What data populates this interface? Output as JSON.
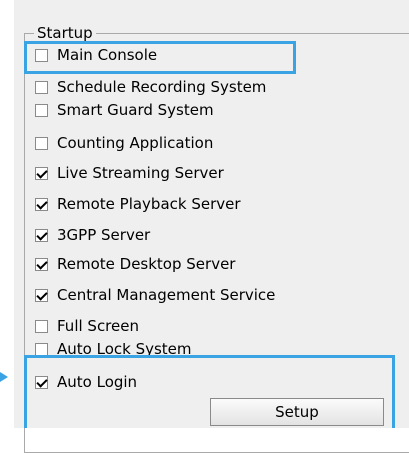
{
  "group": {
    "title": "Startup"
  },
  "items": [
    {
      "label": "Main Console",
      "checked": false
    },
    {
      "label": "Schedule Recording System",
      "checked": false
    },
    {
      "label": "Smart Guard System",
      "checked": false
    },
    {
      "label": "Counting Application",
      "checked": false
    },
    {
      "label": "Live Streaming Server",
      "checked": true
    },
    {
      "label": "Remote Playback Server",
      "checked": true
    },
    {
      "label": "3GPP Server",
      "checked": true
    },
    {
      "label": "Remote Desktop Server",
      "checked": true
    },
    {
      "label": "Central Management Service",
      "checked": true
    },
    {
      "label": "Full Screen",
      "checked": false
    },
    {
      "label": "Auto Lock System",
      "checked": false
    },
    {
      "label": "Auto Login",
      "checked": true
    }
  ],
  "buttons": {
    "setup": "Setup"
  },
  "colors": {
    "highlight": "#3aa3e3",
    "panel_bg": "#efefef"
  }
}
